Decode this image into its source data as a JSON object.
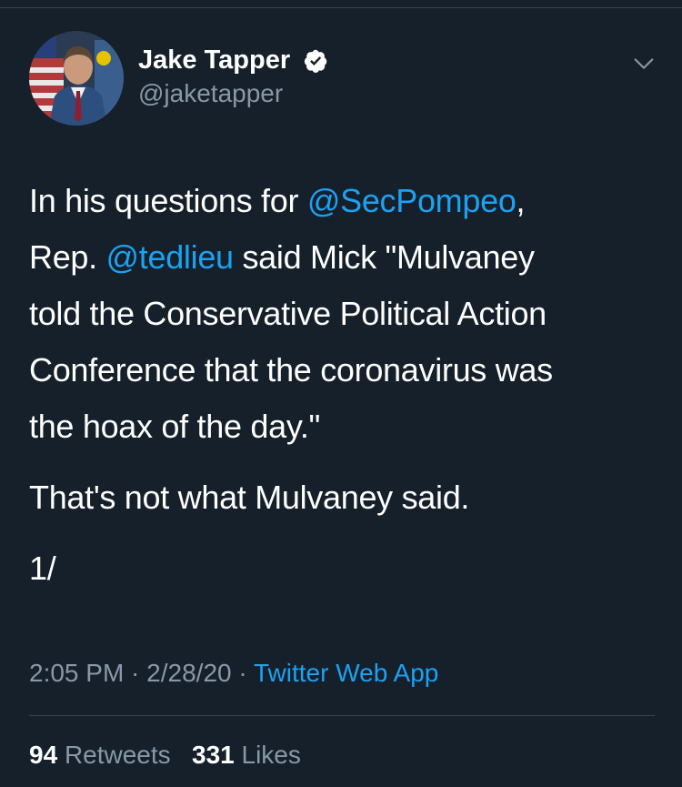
{
  "author": {
    "name": "Jake Tapper",
    "handle": "@jaketapper",
    "verified": true
  },
  "icons": {
    "verified": "verified-badge-icon",
    "menu": "chevron-down-icon"
  },
  "tweet": {
    "line1_pre": "In his questions for ",
    "mention1": "@SecPompeo",
    "line1_post": ",",
    "line2_pre": "Rep. ",
    "mention2": "@tedlieu",
    "line2_post": " said Mick \"Mulvaney",
    "line3": "told the Conservative Political Action",
    "line4": "Conference that the coronavirus was",
    "line5": "the hoax of the day.\"",
    "paragraph2": "That's not what Mulvaney said.",
    "paragraph3": "1/"
  },
  "meta": {
    "time": "2:05 PM",
    "date": "2/28/20",
    "separator": " · ",
    "source": "Twitter Web App"
  },
  "stats": {
    "retweets_count": "94",
    "retweets_label": "Retweets",
    "likes_count": "331",
    "likes_label": "Likes"
  },
  "colors": {
    "background": "#15202b",
    "text": "#ffffff",
    "secondary": "#8899a6",
    "accent": "#1da1f2",
    "divider": "#38444d"
  }
}
